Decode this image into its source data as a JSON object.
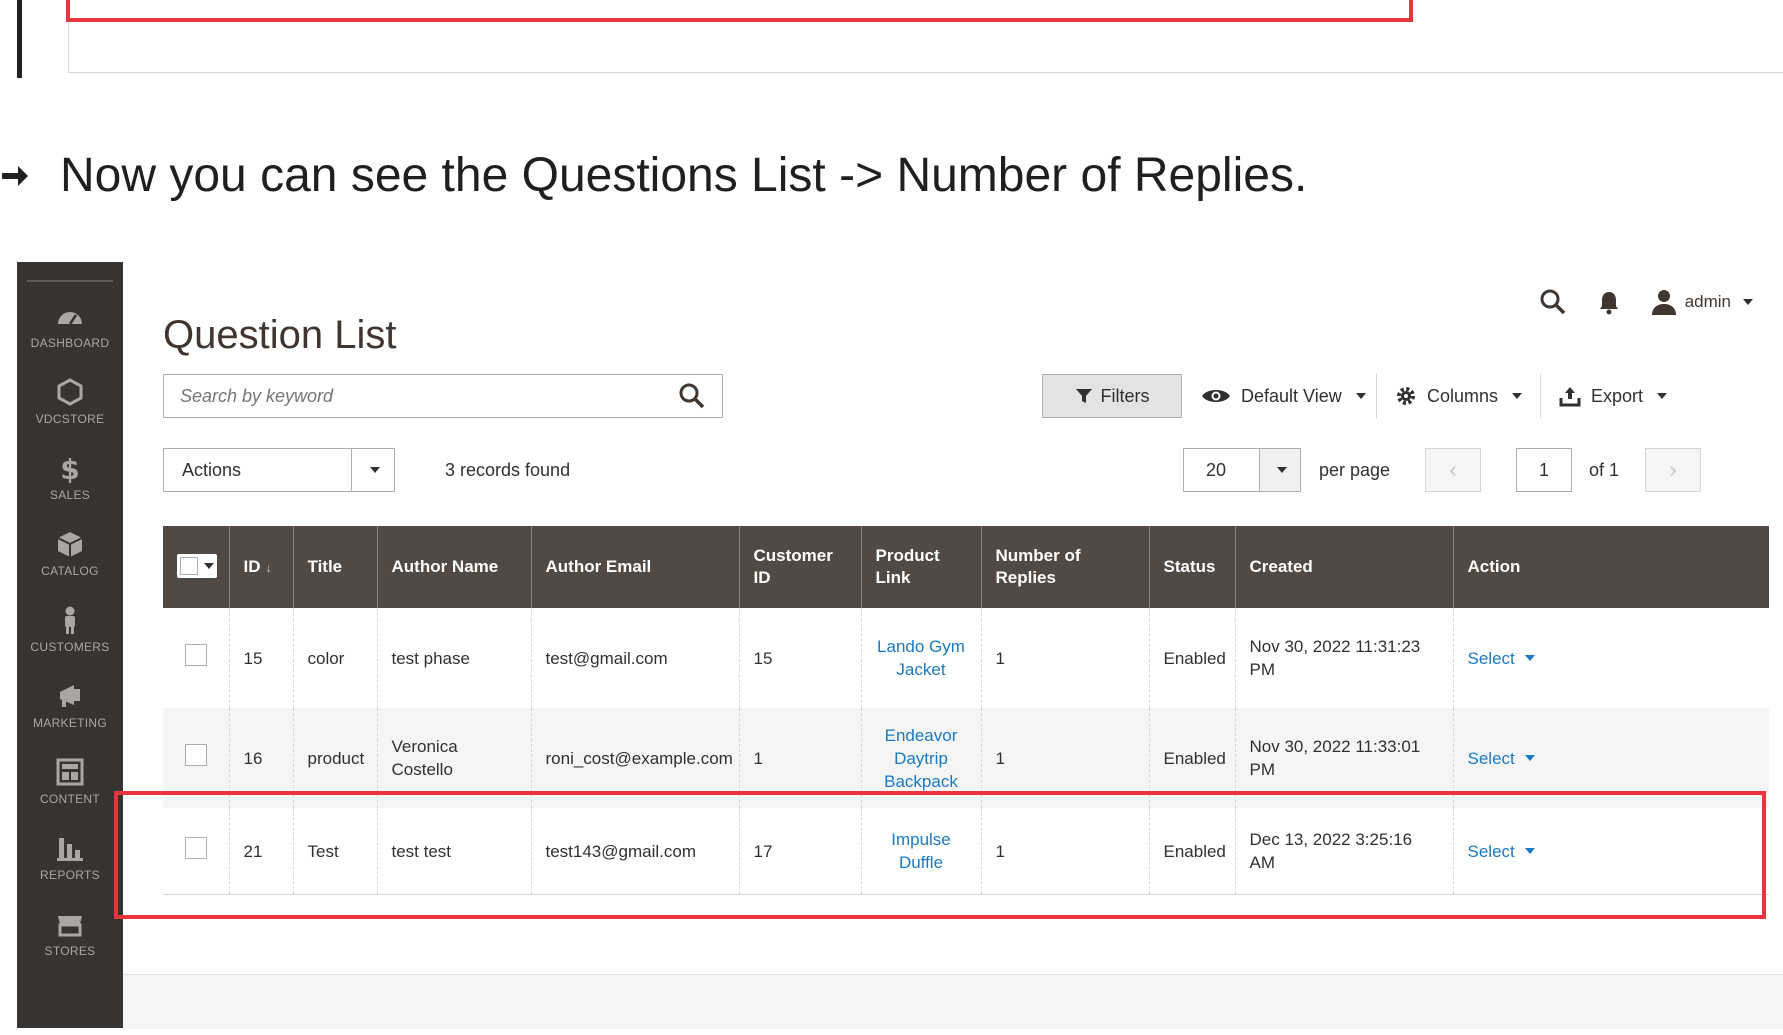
{
  "instruction": {
    "arrow": "➔",
    "text": "Now you can see the Questions List -> Number of Replies."
  },
  "sidebar": {
    "items": [
      {
        "label": "DASHBOARD",
        "icon": "dashboard-icon"
      },
      {
        "label": "VDCSTORE",
        "icon": "hexagon-icon"
      },
      {
        "label": "SALES",
        "icon": "dollar-icon"
      },
      {
        "label": "CATALOG",
        "icon": "box-icon"
      },
      {
        "label": "CUSTOMERS",
        "icon": "person-icon"
      },
      {
        "label": "MARKETING",
        "icon": "megaphone-icon"
      },
      {
        "label": "CONTENT",
        "icon": "layout-icon"
      },
      {
        "label": "REPORTS",
        "icon": "bar-chart-icon"
      },
      {
        "label": "STORES",
        "icon": "store-icon"
      }
    ]
  },
  "header": {
    "title": "Question List",
    "user": "admin"
  },
  "search": {
    "placeholder": "Search by keyword",
    "value": ""
  },
  "toolbar": {
    "filters": "Filters",
    "default_view": "Default View",
    "columns": "Columns",
    "export": "Export"
  },
  "massactions": {
    "actions_label": "Actions",
    "records_found": "3 records found"
  },
  "pagination": {
    "per_page_value": "20",
    "per_page_label": "per page",
    "current_page": "1",
    "total_label": "of 1",
    "prev": "‹",
    "next": "›"
  },
  "table": {
    "columns": [
      "ID",
      "Title",
      "Author Name",
      "Author Email",
      "Customer ID",
      "Product Link",
      "Number of Replies",
      "Status",
      "Created",
      "Action"
    ],
    "sort_indicator": "↓",
    "rows": [
      {
        "id": "15",
        "title": "color",
        "author_name": "test phase",
        "author_email": "test@gmail.com",
        "customer_id": "15",
        "product_link": "Lando Gym Jacket",
        "replies": "1",
        "status": "Enabled",
        "created": "Nov 30, 2022 11:31:23 PM",
        "action": "Select"
      },
      {
        "id": "16",
        "title": "product",
        "author_name": "Veronica Costello",
        "author_email": "roni_cost@example.com",
        "customer_id": "1",
        "product_link": "Endeavor Daytrip Backpack",
        "replies": "1",
        "status": "Enabled",
        "created": "Nov 30, 2022 11:33:01 PM",
        "action": "Select"
      },
      {
        "id": "21",
        "title": "Test",
        "author_name": "test test",
        "author_email": "test143@gmail.com",
        "customer_id": "17",
        "product_link": "Impulse Duffle",
        "replies": "1",
        "status": "Enabled",
        "created": "Dec 13, 2022 3:25:16 AM",
        "action": "Select"
      }
    ]
  },
  "colors": {
    "sidebar_bg": "#373330",
    "table_header_bg": "#514943",
    "link": "#1979c3",
    "highlight": "#e8343b"
  }
}
